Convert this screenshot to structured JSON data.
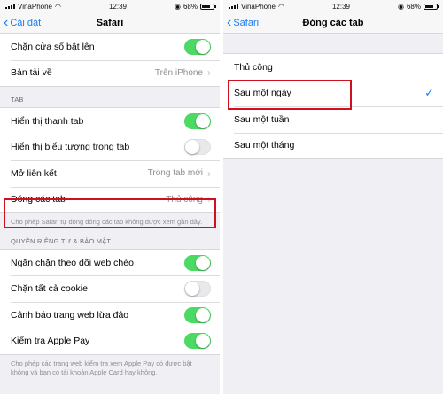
{
  "left": {
    "status": {
      "carrier": "VinaPhone",
      "time": "12:39",
      "battery": "68%"
    },
    "nav": {
      "back_label": "Cài đặt",
      "title": "Safari"
    },
    "top_rows": [
      {
        "label": "Chặn cửa sổ bật lên",
        "toggle": "on"
      },
      {
        "label": "Bản tải về",
        "value": "Trên iPhone"
      }
    ],
    "tab_section": {
      "header": "TAB",
      "rows": [
        {
          "label": "Hiển thị thanh tab",
          "toggle": "on"
        },
        {
          "label": "Hiển thị biểu tượng trong tab",
          "toggle": "off"
        },
        {
          "label": "Mở liên kết",
          "value": "Trong tab mới"
        },
        {
          "label": "Đóng các tab",
          "value": "Thủ công"
        }
      ],
      "footer": "Cho phép Safari tự động đóng các tab không được xem gần đây."
    },
    "privacy_section": {
      "header": "QUYỀN RIÊNG TƯ & BẢO MẬT",
      "rows": [
        {
          "label": "Ngăn chặn theo dõi web chéo",
          "toggle": "on"
        },
        {
          "label": "Chặn tất cả cookie",
          "toggle": "off"
        },
        {
          "label": "Cảnh báo trang web lừa đảo",
          "toggle": "on"
        },
        {
          "label": "Kiểm tra Apple Pay",
          "toggle": "on"
        }
      ],
      "footer": "Cho phép các trang web kiểm tra xem Apple Pay có được bật không và bạn có tài khoản Apple Card hay không."
    }
  },
  "right": {
    "status": {
      "carrier": "VinaPhone",
      "time": "12:39",
      "battery": "68%"
    },
    "nav": {
      "back_label": "Safari",
      "title": "Đóng các tab"
    },
    "options": [
      {
        "label": "Thủ công",
        "selected": false
      },
      {
        "label": "Sau một ngày",
        "selected": true
      },
      {
        "label": "Sau một tuần",
        "selected": false
      },
      {
        "label": "Sau một tháng",
        "selected": false
      }
    ],
    "check_glyph": "✓"
  },
  "colors": {
    "accent": "#1a7cf5",
    "toggle_on": "#4cd964",
    "highlight": "#d0101e"
  }
}
